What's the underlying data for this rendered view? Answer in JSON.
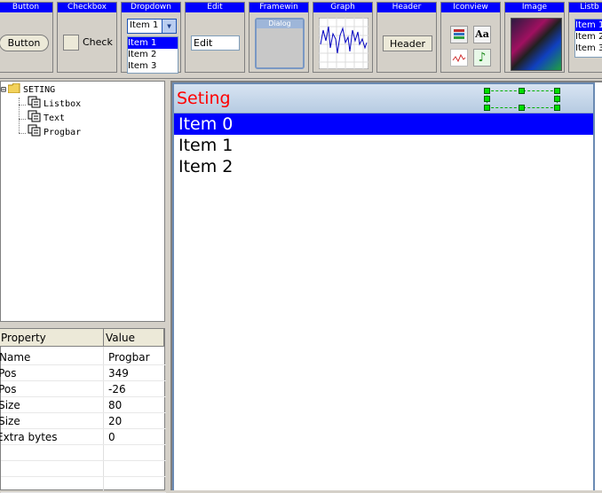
{
  "palette": {
    "button": {
      "title": "Button",
      "label": "Button"
    },
    "checkbox": {
      "title": "Checkbox",
      "label": "Check"
    },
    "dropdown": {
      "title": "Dropdown",
      "selected": "Item 1",
      "items": [
        "Item 1",
        "Item 2",
        "Item 3"
      ]
    },
    "edit": {
      "title": "Edit",
      "value": "Edit"
    },
    "framewin": {
      "title": "Framewin",
      "caption": "Dialog"
    },
    "graph": {
      "title": "Graph"
    },
    "header": {
      "title": "Header",
      "label": "Header"
    },
    "iconview": {
      "title": "Iconview",
      "icons": [
        "books-icon",
        "font-aa-icon",
        "chart-wave-icon",
        "music-note-icon"
      ]
    },
    "image": {
      "title": "Image"
    },
    "listbox": {
      "title": "Listb",
      "items": [
        "Item 1",
        "Item 2",
        "Item 3"
      ]
    }
  },
  "tree": {
    "root": {
      "label": "SETING",
      "expander": "⊟"
    },
    "children": [
      {
        "label": "Listbox"
      },
      {
        "label": "Text"
      },
      {
        "label": "Progbar"
      }
    ]
  },
  "properties": {
    "headers": {
      "property": "Property",
      "value": "Value"
    },
    "rows": [
      {
        "name": "Name",
        "value": "Progbar"
      },
      {
        "name": "xPos",
        "value": "349"
      },
      {
        "name": "yPos",
        "value": "-26"
      },
      {
        "name": "xSize",
        "value": "80"
      },
      {
        "name": "ySize",
        "value": "20"
      },
      {
        "name": "Extra bytes",
        "value": "0"
      },
      {
        "name": "",
        "value": ""
      },
      {
        "name": "",
        "value": ""
      },
      {
        "name": "",
        "value": ""
      }
    ]
  },
  "framewin": {
    "title": "Seting",
    "title_color": "#ff0000",
    "listbox": {
      "items": [
        "Item 0",
        "Item 1",
        "Item 2"
      ],
      "selected_index": 0
    }
  },
  "colors": {
    "accent": "#0000ff",
    "selection": "#0000ff",
    "handle": "#00e000"
  }
}
